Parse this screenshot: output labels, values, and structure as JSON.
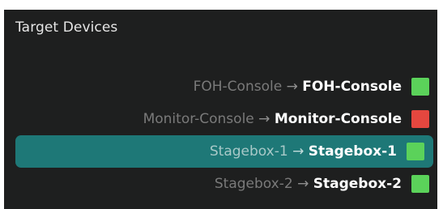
{
  "panel": {
    "title": "Target Devices"
  },
  "devices": [
    {
      "source": "FOH-Console",
      "arrow": "→",
      "target": "FOH-Console",
      "status": "ok",
      "status_color": "#5bd25a",
      "selected": false
    },
    {
      "source": "Monitor-Console",
      "arrow": "→",
      "target": "Monitor-Console",
      "status": "error",
      "status_color": "#e5473f",
      "selected": false
    },
    {
      "source": "Stagebox-1",
      "arrow": "→",
      "target": "Stagebox-1",
      "status": "ok",
      "status_color": "#5bd25a",
      "selected": true
    },
    {
      "source": "Stagebox-2",
      "arrow": "→",
      "target": "Stagebox-2",
      "status": "ok",
      "status_color": "#5bd25a",
      "selected": false
    }
  ],
  "colors": {
    "panel_background": "#1e1f1f",
    "selected_row": "#1e7877",
    "ok": "#5bd25a",
    "error": "#e5473f"
  }
}
